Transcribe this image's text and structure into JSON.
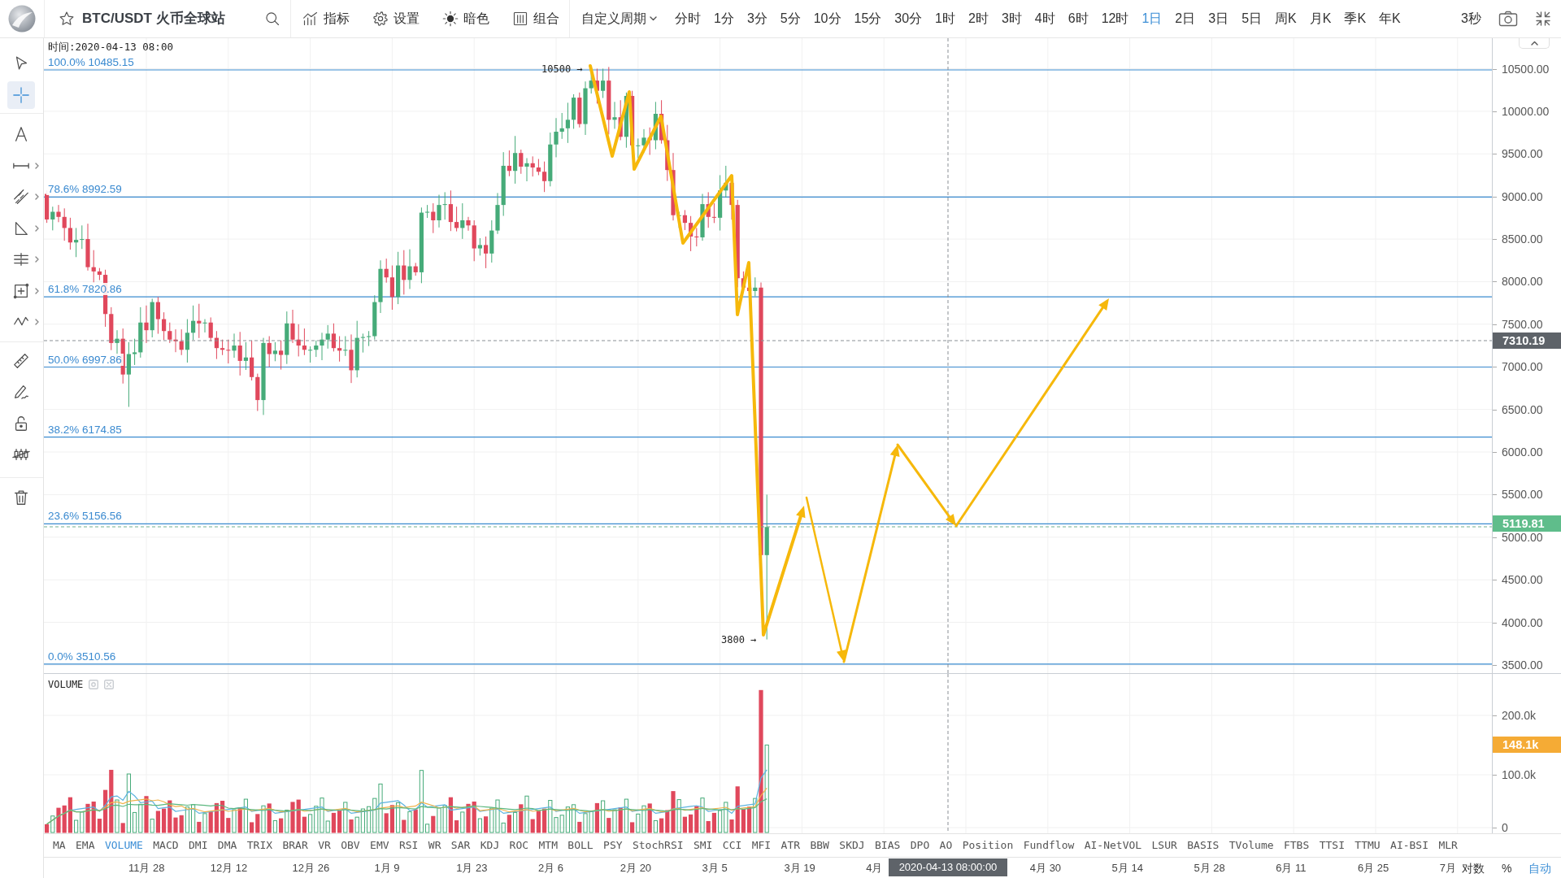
{
  "toolbar": {
    "symbol": "BTC/USDT 火币全球站",
    "tools": [
      {
        "kind": "indicators",
        "label": "指标"
      },
      {
        "kind": "settings",
        "label": "设置"
      },
      {
        "kind": "theme",
        "label": "暗色"
      },
      {
        "kind": "layout",
        "label": "组合"
      }
    ],
    "custom_period": "自定义周期",
    "periods": [
      {
        "label": "分时",
        "selected": false
      },
      {
        "label": "1分",
        "selected": false
      },
      {
        "label": "3分",
        "selected": false
      },
      {
        "label": "5分",
        "selected": false
      },
      {
        "label": "10分",
        "selected": false
      },
      {
        "label": "15分",
        "selected": false
      },
      {
        "label": "30分",
        "selected": false
      },
      {
        "label": "1时",
        "selected": false
      },
      {
        "label": "2时",
        "selected": false
      },
      {
        "label": "3时",
        "selected": false
      },
      {
        "label": "4时",
        "selected": false
      },
      {
        "label": "6时",
        "selected": false
      },
      {
        "label": "12时",
        "selected": false
      },
      {
        "label": "1日",
        "selected": true
      },
      {
        "label": "2日",
        "selected": false
      },
      {
        "label": "3日",
        "selected": false
      },
      {
        "label": "5日",
        "selected": false
      },
      {
        "label": "周K",
        "selected": false
      },
      {
        "label": "月K",
        "selected": false
      },
      {
        "label": "季K",
        "selected": false
      },
      {
        "label": "年K",
        "selected": false
      }
    ],
    "refresh_interval": "3秒"
  },
  "drawing_tools": [
    {
      "tools": [
        {
          "kind": "pointer",
          "selected": false,
          "submenu": false
        },
        {
          "kind": "crosshair",
          "selected": true,
          "submenu": false
        }
      ]
    },
    {
      "tools": [
        {
          "kind": "text",
          "selected": false,
          "submenu": false
        },
        {
          "kind": "segment",
          "selected": false,
          "submenu": true
        },
        {
          "kind": "channel",
          "selected": false,
          "submenu": true
        },
        {
          "kind": "triangle",
          "selected": false,
          "submenu": true
        },
        {
          "kind": "hlines",
          "selected": false,
          "submenu": true
        },
        {
          "kind": "box",
          "selected": false,
          "submenu": true
        },
        {
          "kind": "wave",
          "selected": false,
          "submenu": true
        }
      ]
    },
    {
      "tools": [
        {
          "kind": "ruler",
          "selected": false,
          "submenu": false
        },
        {
          "kind": "pen",
          "selected": false,
          "submenu": false
        },
        {
          "kind": "lock",
          "selected": false,
          "submenu": false
        },
        {
          "kind": "hide",
          "selected": false,
          "submenu": false
        }
      ]
    },
    {
      "tools": [
        {
          "kind": "trash",
          "selected": false,
          "submenu": false
        }
      ]
    }
  ],
  "chart": {
    "readout": "时间:2020-04-13 08:00",
    "fib_levels": [
      {
        "label": "100.0% 10485.15"
      },
      {
        "label": "78.6% 8992.59"
      },
      {
        "label": "61.8% 7820.86"
      },
      {
        "label": "50.0% 6997.86"
      },
      {
        "label": "38.2% 6174.85"
      },
      {
        "label": "23.6% 5156.56"
      },
      {
        "label": "0.0% 3510.56"
      }
    ],
    "annotations": [
      {
        "text": "10500 →"
      },
      {
        "text": "3800 →"
      }
    ],
    "price_axis": [
      "10500.00",
      "10000.00",
      "9500.00",
      "9000.00",
      "8500.00",
      "8000.00",
      "7500.00",
      "7000.00",
      "6500.00",
      "6000.00",
      "5500.00",
      "5000.00",
      "4500.00",
      "4000.00",
      "3500.00"
    ],
    "price_tags": [
      {
        "text": "7310.19",
        "color": "#5e6369"
      },
      {
        "text": "5119.81",
        "color": "#5fbd8b"
      }
    ]
  },
  "volume": {
    "title": "VOLUME",
    "axis": [
      "200.0k",
      "100.0k",
      "0"
    ],
    "price_tag": {
      "text": "148.1k",
      "color": "#f5ab35"
    }
  },
  "indicators": [
    {
      "label": "MA",
      "selected": false
    },
    {
      "label": "EMA",
      "selected": false
    },
    {
      "label": "VOLUME",
      "selected": true
    },
    {
      "label": "MACD",
      "selected": false
    },
    {
      "label": "DMI",
      "selected": false
    },
    {
      "label": "DMA",
      "selected": false
    },
    {
      "label": "TRIX",
      "selected": false
    },
    {
      "label": "BRAR",
      "selected": false
    },
    {
      "label": "VR",
      "selected": false
    },
    {
      "label": "OBV",
      "selected": false
    },
    {
      "label": "EMV",
      "selected": false
    },
    {
      "label": "RSI",
      "selected": false
    },
    {
      "label": "WR",
      "selected": false
    },
    {
      "label": "SAR",
      "selected": false
    },
    {
      "label": "KDJ",
      "selected": false
    },
    {
      "label": "ROC",
      "selected": false
    },
    {
      "label": "MTM",
      "selected": false
    },
    {
      "label": "BOLL",
      "selected": false
    },
    {
      "label": "PSY",
      "selected": false
    },
    {
      "label": "StochRSI",
      "selected": false
    },
    {
      "label": "SMI",
      "selected": false
    },
    {
      "label": "CCI",
      "selected": false
    },
    {
      "label": "MFI",
      "selected": false
    },
    {
      "label": "ATR",
      "selected": false
    },
    {
      "label": "BBW",
      "selected": false
    },
    {
      "label": "SKDJ",
      "selected": false
    },
    {
      "label": "BIAS",
      "selected": false
    },
    {
      "label": "DPO",
      "selected": false
    },
    {
      "label": "AO",
      "selected": false
    },
    {
      "label": "Position",
      "selected": false
    },
    {
      "label": "Fundflow",
      "selected": false
    },
    {
      "label": "AI-NetVOL",
      "selected": false
    },
    {
      "label": "LSUR",
      "selected": false
    },
    {
      "label": "BASIS",
      "selected": false
    },
    {
      "label": "TVolume",
      "selected": false
    },
    {
      "label": "FTBS",
      "selected": false
    },
    {
      "label": "TTSI",
      "selected": false
    },
    {
      "label": "TTMU",
      "selected": false
    },
    {
      "label": "AI-BSI",
      "selected": false
    },
    {
      "label": "MLR",
      "selected": false
    }
  ],
  "time_axis": {
    "dates": [
      "11月 28",
      "12月 12",
      "12月 26",
      "1月 9",
      "1月 23",
      "2月 6",
      "2月 20",
      "3月 5",
      "3月 19",
      "4月",
      "4月 30",
      "5月 14",
      "5月 28",
      "6月 11",
      "6月 25",
      "7月"
    ],
    "crosshair_tag": "2020-04-13 08:00:00",
    "scale_options": [
      {
        "label": "对数",
        "selected": false
      },
      {
        "label": "%",
        "selected": false
      },
      {
        "label": "自动",
        "selected": true
      }
    ]
  }
}
